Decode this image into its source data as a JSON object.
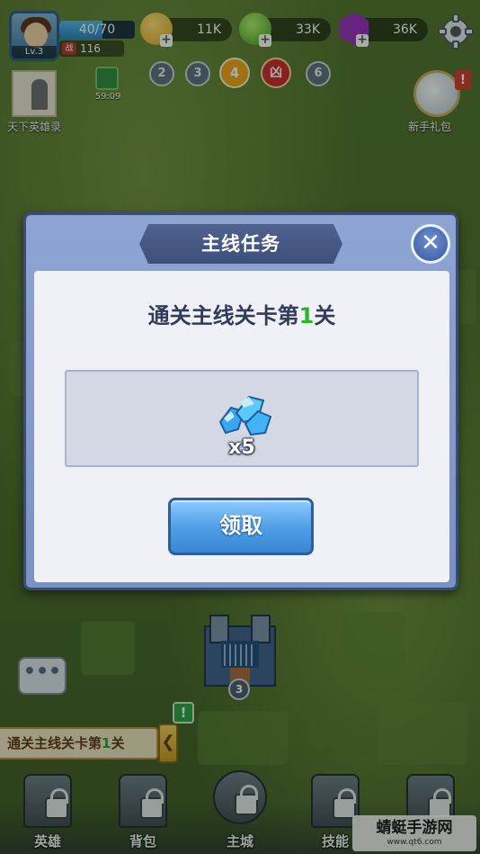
{
  "hud": {
    "player_level": "Lv.3",
    "energy": "40/70",
    "energy_fraction": 0.571,
    "power_tag": "战",
    "power_value": "116",
    "gold": "11K",
    "green_resource": "33K",
    "purple_resource": "36K"
  },
  "stage_chips": [
    "2",
    "3",
    "4",
    "凶",
    "6"
  ],
  "side_left": {
    "label": "天下英雄录"
  },
  "timer": {
    "value": "59:09"
  },
  "gift": {
    "label": "新手礼包",
    "alert": "!"
  },
  "dialog": {
    "title": "主线任务",
    "task_prefix": "通关主线关卡第",
    "task_number": "1",
    "task_suffix": "关",
    "reward_count": "x5",
    "claim_label": "领取"
  },
  "map": {
    "castle_level": "3",
    "chat_icon": "•••"
  },
  "quest_tracker": {
    "prefix": "通关主线关卡第",
    "number": "1",
    "suffix": "关",
    "arrow": "❮",
    "alert": "!"
  },
  "bottom_nav": {
    "items": [
      {
        "label": "英雄"
      },
      {
        "label": "背包"
      },
      {
        "label": "主城"
      },
      {
        "label": "技能"
      },
      {
        "label": ""
      }
    ]
  },
  "watermark": {
    "title": "蜻蜓手游网",
    "sub": "www.qt6.com"
  },
  "colors": {
    "dialog_bg": "#7a91c4",
    "panel_bg": "#eff1f7",
    "claim_button": "#4c9de6",
    "task_number": "#2bb52b"
  }
}
